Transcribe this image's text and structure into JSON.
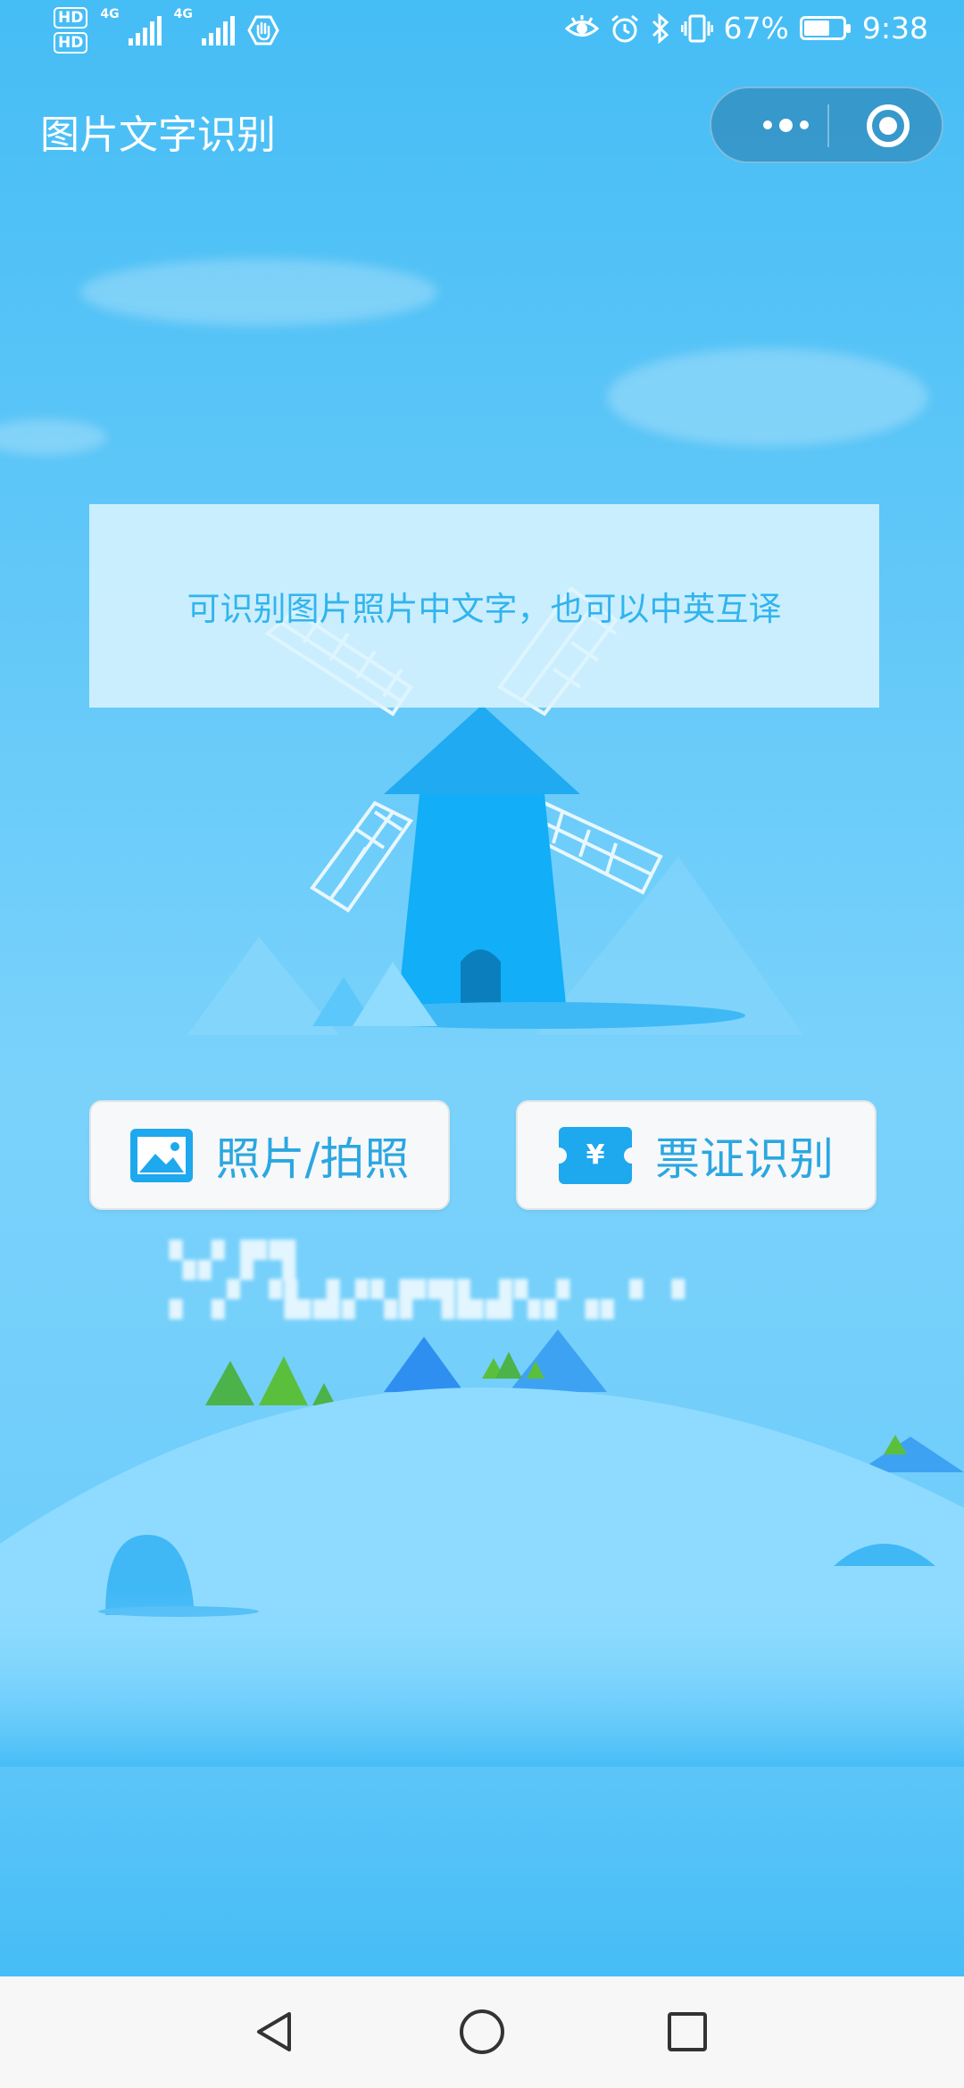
{
  "status_bar": {
    "hd1": "HD",
    "hd2": "HD",
    "net1": "4G",
    "net2": "4G",
    "battery_percent_label": "67%",
    "battery_level": 0.67,
    "time": "9:38",
    "icons": [
      "eye-icon",
      "alarm-icon",
      "bluetooth-icon",
      "vibrate-icon",
      "battery-icon"
    ]
  },
  "navbar": {
    "title": "图片文字识别",
    "menu_icon": "more-dots-icon",
    "close_icon": "target-circle-icon"
  },
  "banner": {
    "text": "可识别图片照片中文字，也可以中英互译"
  },
  "actions": {
    "photo_button": {
      "label": "照片/拍照",
      "icon": "image-icon"
    },
    "ticket_button": {
      "label": "票证识别",
      "icon": "ticket-yen-icon",
      "icon_glyph": "¥"
    }
  },
  "obscured_line": {
    "text": "▚▞ ▛▜ ▖▗▘▝▙▟▞▚▛▜▙▟▚▞▗▖▘▝"
  },
  "colors": {
    "background_top": "#45bdf5",
    "background_mid": "#7ad2fb",
    "accent": "#1ea8ee",
    "button_text": "#2ba7e1",
    "banner_text": "#31b4ee"
  },
  "system_nav": {
    "back": "back-triangle-icon",
    "home": "home-circle-icon",
    "recents": "recents-square-icon"
  }
}
